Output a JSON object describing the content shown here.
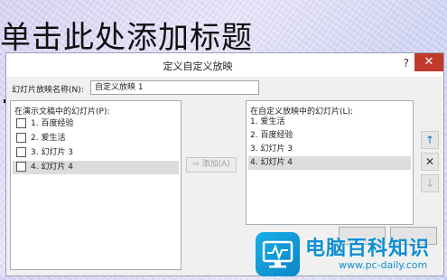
{
  "slide": {
    "title": "单击此处添加标题"
  },
  "dialog": {
    "title": "定义自定义放映",
    "help": "?",
    "close": "✕",
    "name_label": "幻灯片放映名称(N):",
    "name_value": "自定义放映 1",
    "left_list": {
      "header": "在演示文稿中的幻灯片(P):",
      "items": [
        "1. 百度经验",
        "2. 爱生活",
        "3. 幻灯片 3",
        "4. 幻灯片 4"
      ],
      "selected_index": 3
    },
    "add_button": "添加(A)",
    "add_arrow": "⇨",
    "right_list": {
      "header": "在自定义放映中的幻灯片(L):",
      "items": [
        "1. 爱生活",
        "2. 百度经验",
        "3. 幻灯片 3",
        "4. 幻灯片 4"
      ],
      "selected_index": 3
    },
    "move_up": "↑",
    "remove": "✕",
    "move_down": "↓"
  },
  "watermark": {
    "text": "电脑百科知识",
    "url": "www.pc-daily.com"
  },
  "colors": {
    "close_button": "#c0392b",
    "watermark": "#0f8ed0",
    "accent_blue": "#1b6fc2"
  }
}
